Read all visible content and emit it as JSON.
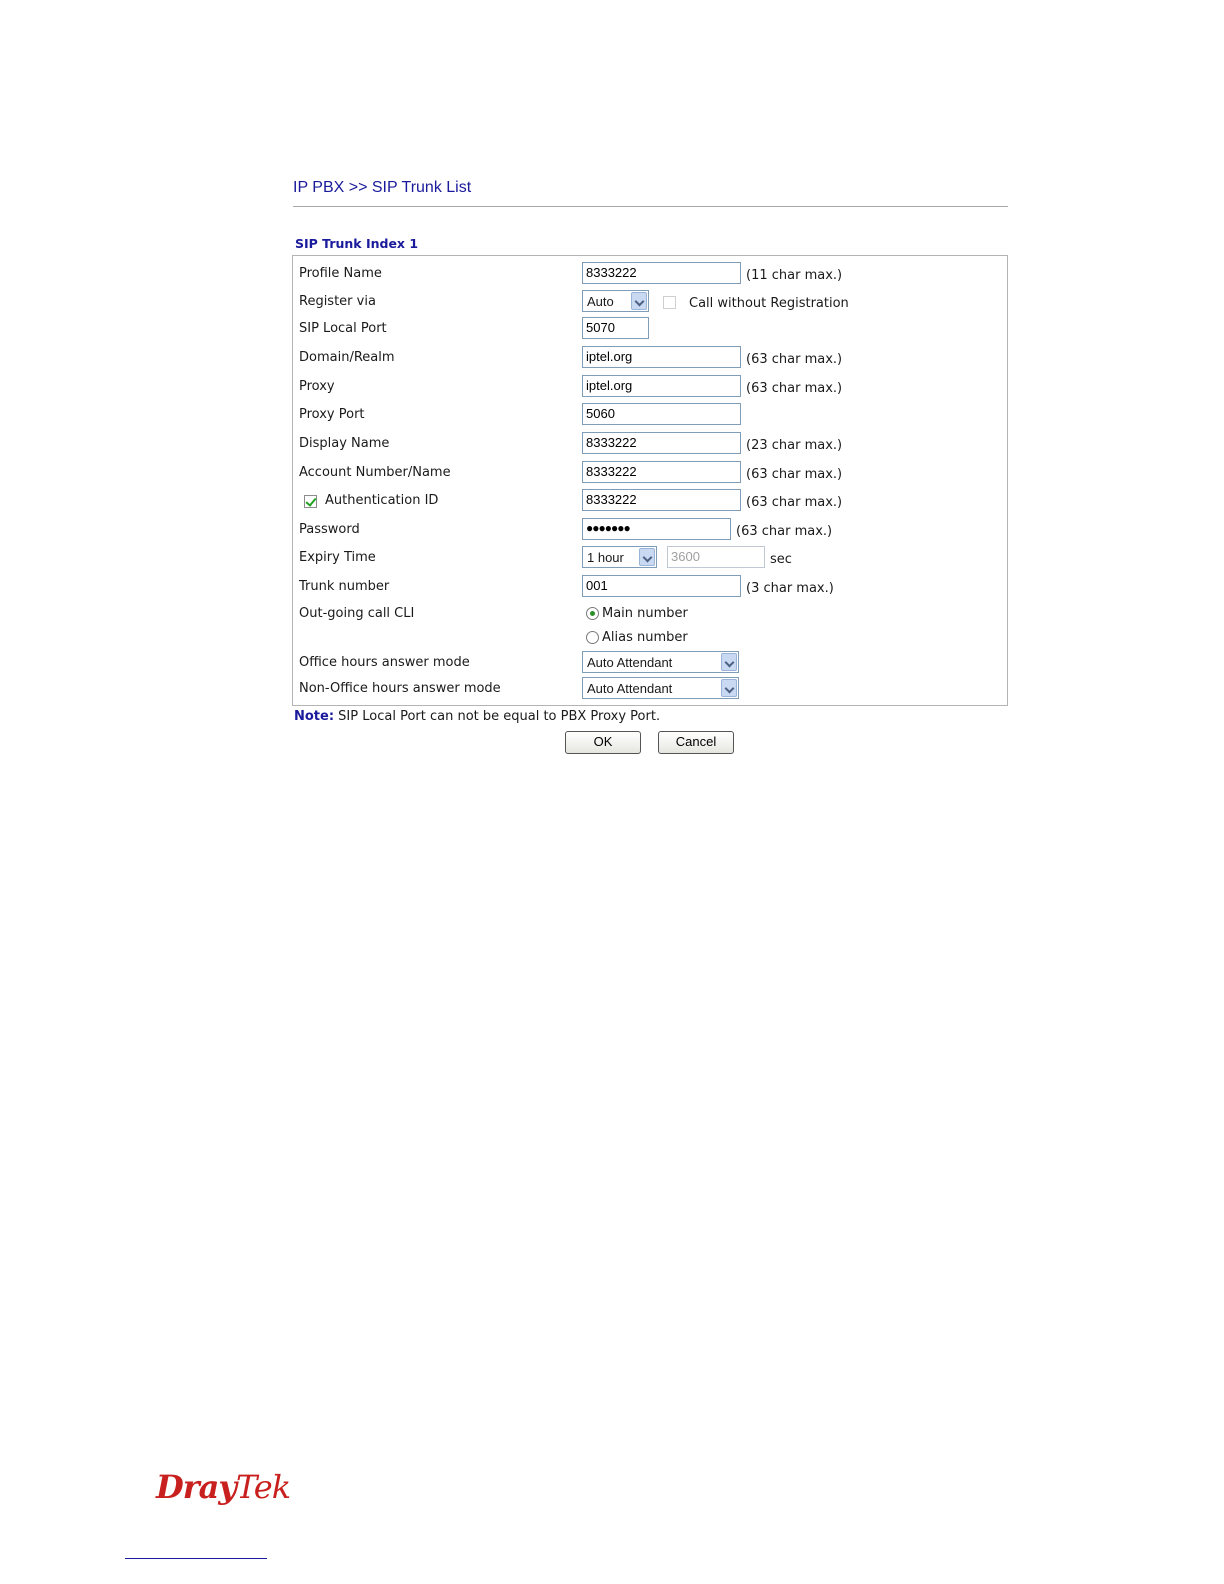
{
  "header": {
    "breadcrumb": "IP PBX >> SIP Trunk List"
  },
  "section_title": "SIP Trunk Index 1",
  "form": {
    "profile_name": {
      "label": "Profile Name",
      "value": "8333222",
      "hint": "(11 char max.)"
    },
    "register_via": {
      "label": "Register via",
      "value": "Auto",
      "call_without_registration_label": "Call without Registration",
      "call_without_registration_checked": false
    },
    "sip_local_port": {
      "label": "SIP Local Port",
      "value": "5070"
    },
    "domain_realm": {
      "label": "Domain/Realm",
      "value": "iptel.org",
      "hint": "(63 char max.)"
    },
    "proxy": {
      "label": "Proxy",
      "value": "iptel.org",
      "hint": "(63 char max.)"
    },
    "proxy_port": {
      "label": "Proxy Port",
      "value": "5060"
    },
    "display_name": {
      "label": "Display Name",
      "value": "8333222",
      "hint": "(23 char max.)"
    },
    "account_number": {
      "label": "Account Number/Name",
      "value": "8333222",
      "hint": "(63 char max.)"
    },
    "authentication_id": {
      "label": "Authentication ID",
      "checked": true,
      "value": "8333222",
      "hint": "(63 char max.)"
    },
    "password": {
      "label": "Password",
      "value": "●●●●●●●",
      "hint": "(63 char max.)"
    },
    "expiry_time": {
      "label": "Expiry Time",
      "value": "1 hour",
      "seconds": "3600",
      "unit": "sec"
    },
    "trunk_number": {
      "label": "Trunk number",
      "value": "001",
      "hint": "(3 char max.)"
    },
    "outgoing_cli": {
      "label": "Out-going call CLI",
      "options": [
        "Main number",
        "Alias number"
      ],
      "selected": "Main number"
    },
    "office_hours": {
      "label": "Office hours answer mode",
      "value": "Auto Attendant"
    },
    "non_office_hours": {
      "label": "Non-Office hours answer mode",
      "value": "Auto Attendant"
    }
  },
  "note": {
    "prefix": "Note:",
    "text": " SIP Local Port can not be equal to PBX Proxy Port."
  },
  "buttons": {
    "ok": "OK",
    "cancel": "Cancel"
  },
  "footer": {
    "logo_dray": "Dray",
    "logo_tek": "Tek"
  },
  "colors": {
    "title": "#1a1a9c",
    "logo": "#c8201e",
    "check": "#21a121"
  }
}
